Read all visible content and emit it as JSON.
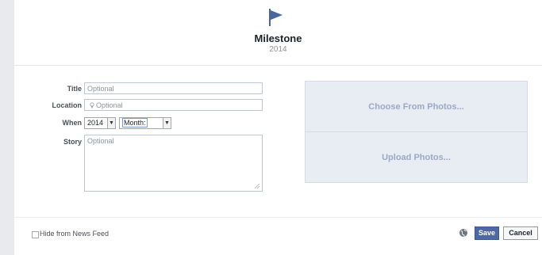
{
  "header": {
    "title": "Milestone",
    "year": "2014"
  },
  "form": {
    "title_label": "Title",
    "title_placeholder": "Optional",
    "location_label": "Location",
    "location_placeholder": "Optional",
    "when_label": "When",
    "year_select": "2014",
    "month_select": "Month:",
    "story_label": "Story",
    "story_placeholder": "Optional"
  },
  "photos": {
    "choose_label": "Choose From Photos...",
    "upload_label": "Upload Photos..."
  },
  "footer": {
    "hide_label": "Hide from News Feed",
    "save_label": "Save",
    "cancel_label": "Cancel"
  },
  "colors": {
    "accent": "#4e69a2",
    "flag": "#4a66a0",
    "photo_bg": "#e8ecf3",
    "photo_text": "#9aa9c7"
  },
  "icons": [
    "flag-icon",
    "location-pin-icon",
    "globe-icon",
    "resize-grip-icon"
  ]
}
